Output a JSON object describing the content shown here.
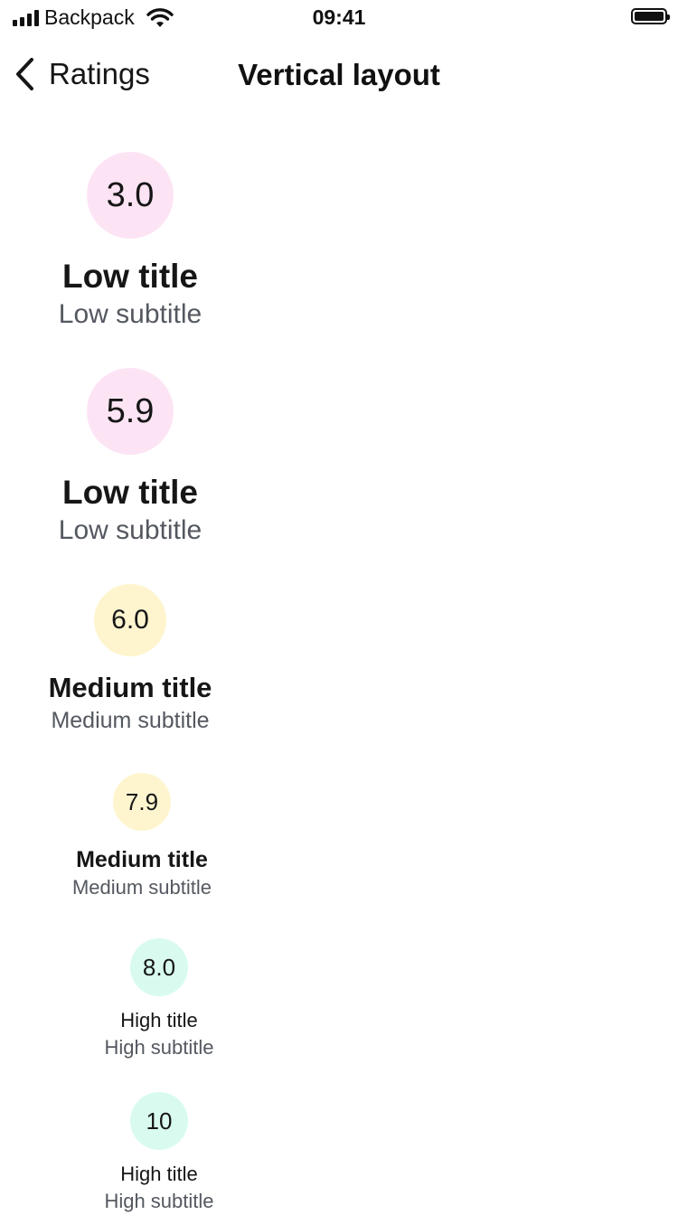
{
  "status_bar": {
    "carrier": "Backpack",
    "time": "09:41"
  },
  "nav": {
    "back_label": "Ratings",
    "title": "Vertical layout"
  },
  "colors": {
    "low": "#FDE4F5",
    "medium": "#FEF5CF",
    "high": "#D9FBEF"
  },
  "ratings": [
    {
      "value": "3.0",
      "level": "low",
      "title": "Low title",
      "subtitle": "Low subtitle"
    },
    {
      "value": "5.9",
      "level": "low",
      "title": "Low title",
      "subtitle": "Low subtitle"
    },
    {
      "value": "6.0",
      "level": "medium",
      "title": "Medium title",
      "subtitle": "Medium subtitle"
    },
    {
      "value": "7.9",
      "level": "medium",
      "title": "Medium title",
      "subtitle": "Medium subtitle"
    },
    {
      "value": "8.0",
      "level": "high",
      "title": "High title",
      "subtitle": "High subtitle"
    },
    {
      "value": "10",
      "level": "high",
      "title": "High title",
      "subtitle": "High subtitle"
    }
  ]
}
